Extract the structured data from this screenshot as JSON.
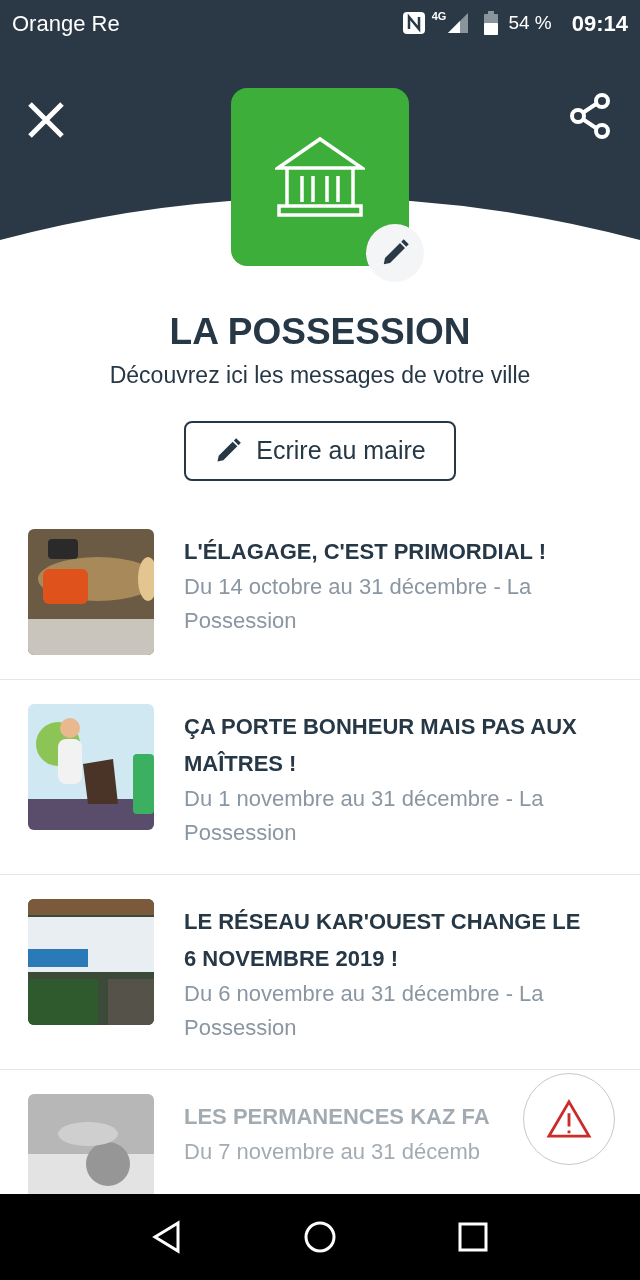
{
  "status_bar": {
    "carrier": "Orange Re",
    "network": "4G",
    "battery": "54 %",
    "time": "09:14"
  },
  "town": {
    "name": "LA POSSESSION",
    "subtitle": "Découvrez ici les messages de votre ville",
    "button": "Ecrire au maire"
  },
  "messages": [
    {
      "title": "L'ÉLAGAGE, C'EST PRIMORDIAL !",
      "dates": "Du 14 octobre au 31 décembre - La Possession",
      "faded": false
    },
    {
      "title": "ÇA PORTE BONHEUR MAIS PAS AUX MAÎTRES !",
      "dates": "Du 1 novembre au 31 décembre - La Possession",
      "faded": false
    },
    {
      "title": "LE RÉSEAU KAR'OUEST CHANGE LE 6 NOVEMBRE 2019 !",
      "dates": "Du 6 novembre au 31 décembre - La Possession",
      "faded": false
    },
    {
      "title": "LES PERMANENCES KAZ FA",
      "dates": "Du 7 novembre au 31 décemb",
      "faded": true
    }
  ]
}
